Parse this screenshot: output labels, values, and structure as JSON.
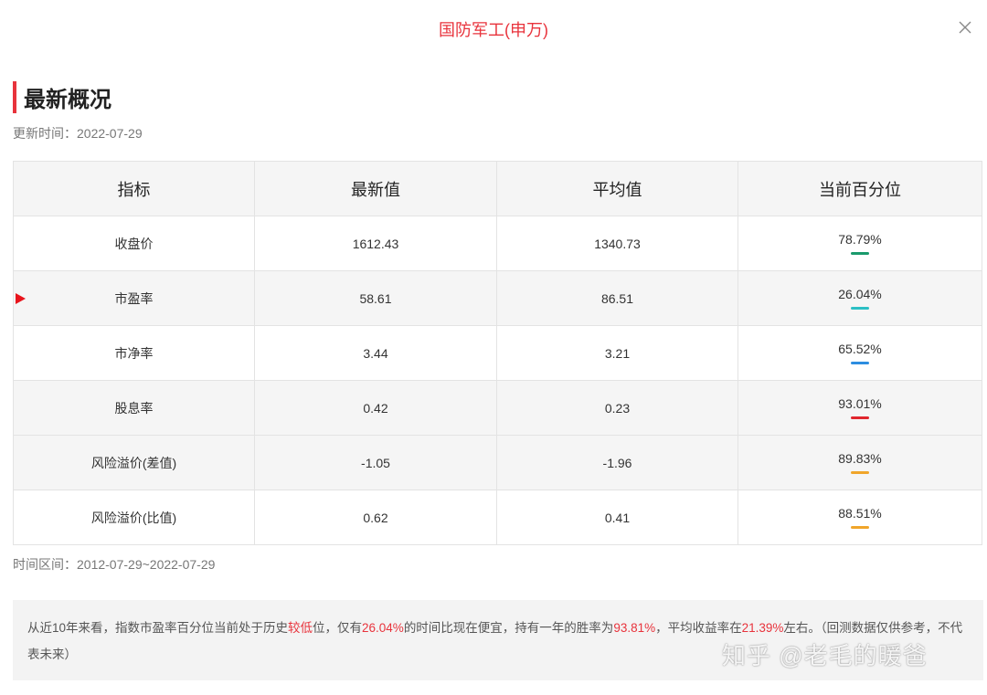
{
  "modal": {
    "title": "国防军工(申万)",
    "close_icon": "close-icon"
  },
  "section": {
    "title": "最新概况",
    "update_label": "更新时间：",
    "update_date": "2022-07-29"
  },
  "table": {
    "headers": [
      "指标",
      "最新值",
      "平均值",
      "当前百分位"
    ],
    "rows": [
      {
        "name": "收盘价",
        "latest": "1612.43",
        "average": "1340.73",
        "percentile": "78.79%",
        "bar_color": "#1a9a6c",
        "shaded": false,
        "selected": false
      },
      {
        "name": "市盈率",
        "latest": "58.61",
        "average": "86.51",
        "percentile": "26.04%",
        "bar_color": "#2bbfc4",
        "shaded": true,
        "selected": true
      },
      {
        "name": "市净率",
        "latest": "3.44",
        "average": "3.21",
        "percentile": "65.52%",
        "bar_color": "#2c8de0",
        "shaded": false,
        "selected": false
      },
      {
        "name": "股息率",
        "latest": "0.42",
        "average": "0.23",
        "percentile": "93.01%",
        "bar_color": "#e0262d",
        "shaded": true,
        "selected": false
      },
      {
        "name": "风险溢价(差值)",
        "latest": "-1.05",
        "average": "-1.96",
        "percentile": "89.83%",
        "bar_color": "#f0a52a",
        "shaded": true,
        "selected": false
      },
      {
        "name": "风险溢价(比值)",
        "latest": "0.62",
        "average": "0.41",
        "percentile": "88.51%",
        "bar_color": "#f0a52a",
        "shaded": false,
        "selected": false
      }
    ]
  },
  "range": {
    "label": "时间区间：",
    "value": "2012-07-29~2022-07-29"
  },
  "conclusion": {
    "t1": "从近10年来看，指数市盈率百分位当前处于历史",
    "h1": "较低",
    "t2": "位，仅有",
    "h2": "26.04%",
    "t3": "的时间比现在便宜，持有一年的胜率为",
    "h3": "93.81%",
    "t4": "，平均收益率在",
    "h4": "21.39%",
    "t5": "左右。（回测数据仅供参考，不代表未来）"
  },
  "watermark": "知乎 @老毛的暖爸",
  "colors": {
    "accent": "#e8333c"
  }
}
